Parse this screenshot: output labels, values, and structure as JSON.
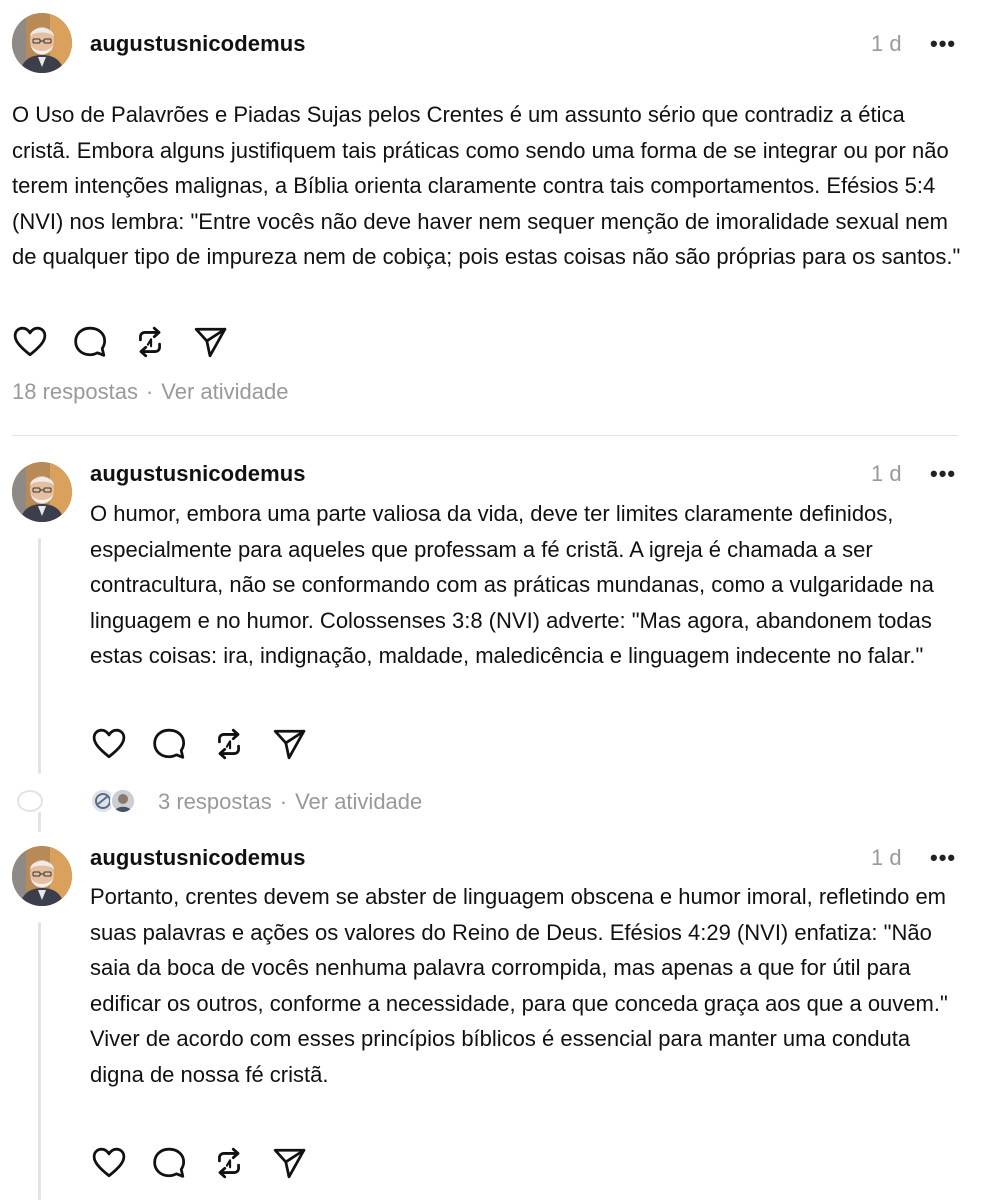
{
  "posts": [
    {
      "username": "augustusnicodemus",
      "time": "1 d",
      "more": "•••",
      "text": "O Uso de Palavrões e Piadas Sujas pelos Crentes é um assunto sério que contradiz a ética cristã. Embora alguns justifiquem tais práticas como sendo uma forma de se integrar ou por não terem intenções malignas, a Bíblia orienta claramente contra tais comportamentos. Efésios 5:4 (NVI) nos lembra: \"Entre vocês não deve haver nem sequer menção de imoralidade sexual nem de qualquer tipo de impureza nem de cobiça; pois estas coisas não são próprias para os santos.\"",
      "replies": "18 respostas",
      "separator": "·",
      "activity": "Ver atividade"
    },
    {
      "username": "augustusnicodemus",
      "time": "1 d",
      "more": "•••",
      "text": "O humor, embora uma parte valiosa da vida, deve ter limites claramente definidos, especialmente para aqueles que professam a fé cristã. A igreja é chamada a ser contracultura, não se conformando com as práticas mundanas, como a vulgaridade na linguagem e no humor. Colossenses 3:8 (NVI) adverte: \"Mas agora, abandonem todas estas coisas: ira, indignação, maldade, maledicência e linguagem indecente no falar.\"",
      "replies": "3 respostas",
      "separator": "·",
      "activity": "Ver atividade"
    },
    {
      "username": "augustusnicodemus",
      "time": "1 d",
      "more": "•••",
      "text": "Portanto, crentes devem se abster de linguagem obscena e humor imoral, refletindo em suas palavras e ações os valores do Reino de Deus. Efésios 4:29 (NVI) enfatiza: \"Não saia da boca de vocês nenhuma palavra corrompida, mas apenas a que for útil para edificar os outros, conforme a necessidade, para que conceda graça aos que a ouvem.\" Viver de acordo com esses princípios bíblicos é essencial para manter uma conduta digna de nossa fé cristã."
    }
  ],
  "icons": {
    "like": "heart-icon",
    "comment": "comment-icon",
    "repost": "repost-icon",
    "share": "send-icon"
  }
}
